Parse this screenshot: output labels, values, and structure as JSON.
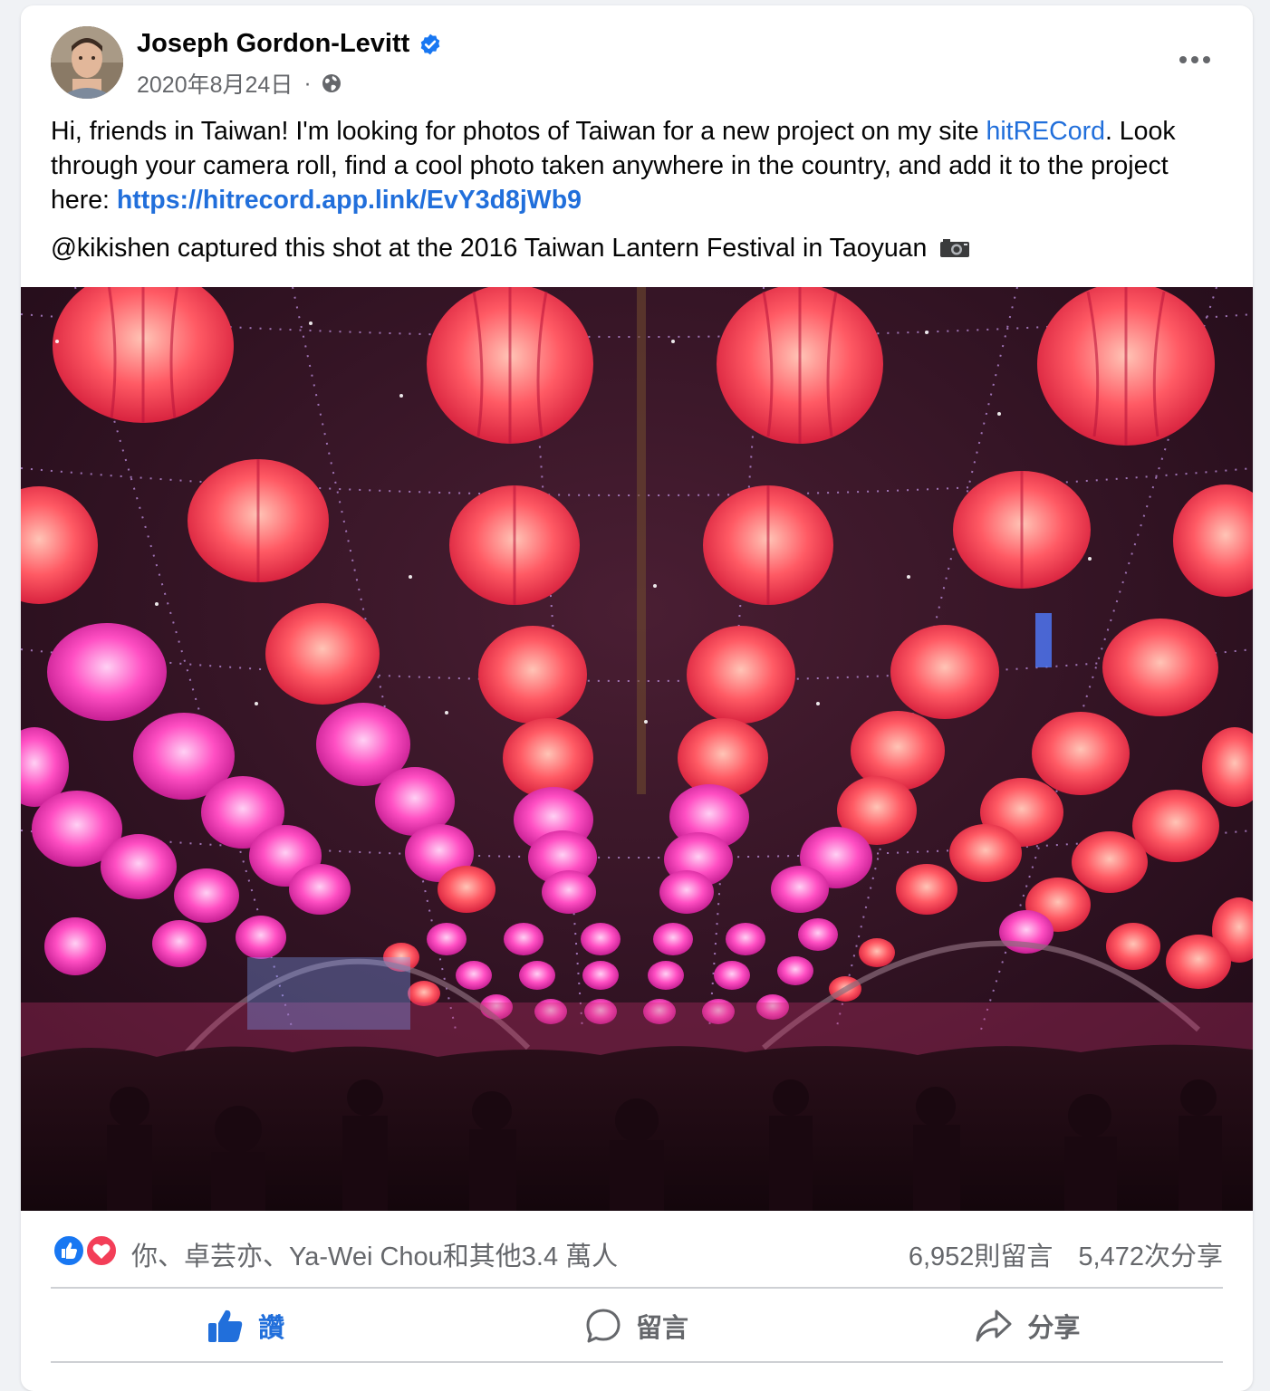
{
  "post": {
    "author": "Joseph Gordon-Levitt",
    "date": "2020年8月24日",
    "separator": "·",
    "text_line_1": "Hi, friends in Taiwan! I'm looking for photos of Taiwan for a new project on my site ",
    "link_site": "hitRECord",
    "text_line_1_end": ".",
    "text_line_2": "Look through your camera roll, find a cool photo taken anywhere in the country, and add it to the project here: ",
    "link_url": "https://hitrecord.app.link/EvY3d8jWb9",
    "caption": "@kikishen captured this shot at the 2016 Taiwan Lantern Festival in Taoyuan",
    "caption_icon": "camera-icon",
    "photo_subject": "lantern-festival-photo"
  },
  "stats": {
    "reactions_text": "你、卓芸亦、Ya-Wei Chou和其他3.4 萬人",
    "comments": "6,952則留言",
    "shares": "5,472次分享",
    "reaction_icons": [
      "like-reaction-icon",
      "love-reaction-icon"
    ]
  },
  "actions": {
    "like_label": "讚",
    "comment_label": "留言",
    "share_label": "分享"
  },
  "colors": {
    "accent": "#216fdb",
    "secondary_text": "#65676b",
    "love": "#f33e58"
  }
}
